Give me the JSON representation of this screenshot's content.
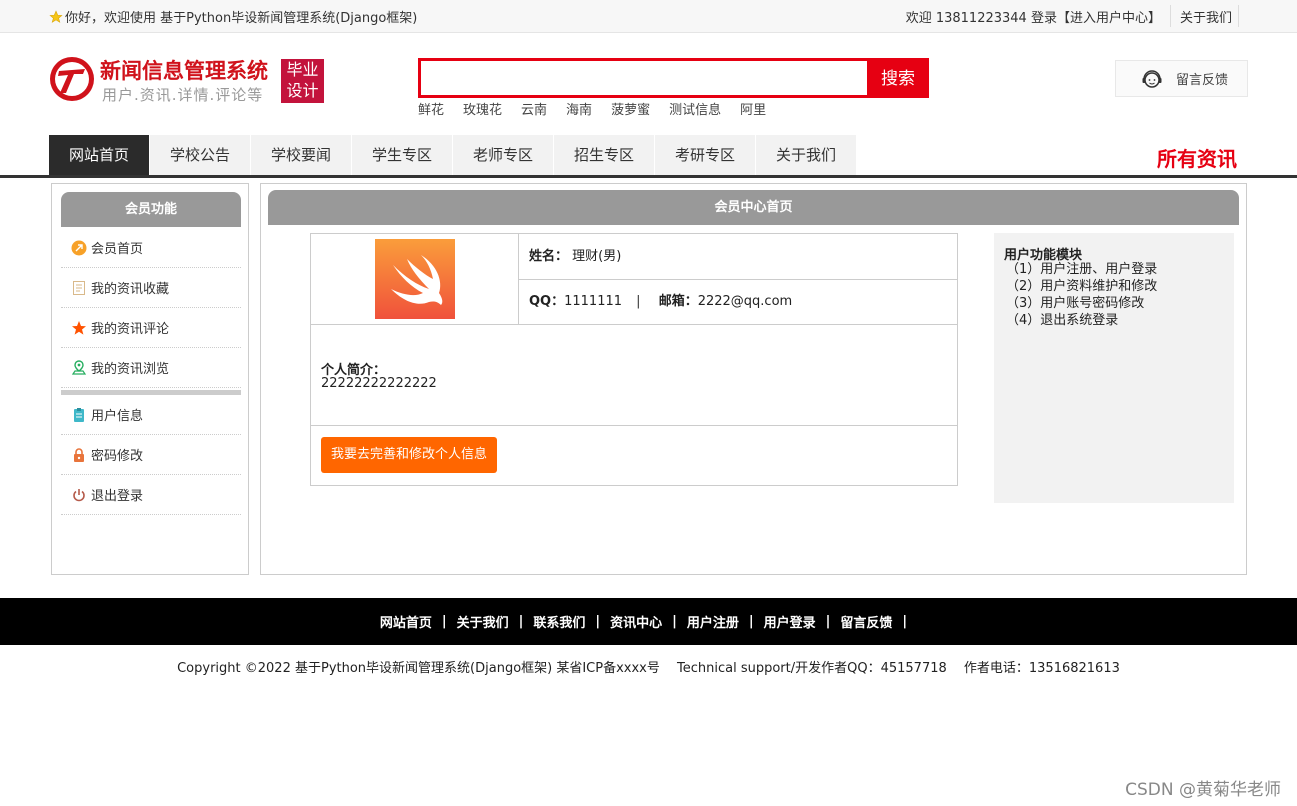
{
  "topbar": {
    "greeting": "你好，欢迎使用 基于Python毕设新闻管理系统(Django框架)",
    "welcome": "欢迎 13811223344 登录",
    "user_center": "【进入用户中心】",
    "about": "关于我们"
  },
  "logo": {
    "title": "新闻信息管理系统",
    "subtitle": "用户.资讯.详情.评论等",
    "badge_line1": "毕业",
    "badge_line2": "设计"
  },
  "search": {
    "value": "",
    "button": "搜索",
    "hotwords": [
      "鲜花",
      "玫瑰花",
      "云南",
      "海南",
      "菠萝蜜",
      "测试信息",
      "阿里"
    ]
  },
  "feedback": {
    "label": "留言反馈"
  },
  "nav": {
    "items": [
      "网站首页",
      "学校公告",
      "学校要闻",
      "学生专区",
      "老师专区",
      "招生专区",
      "考研专区",
      "关于我们"
    ],
    "right": "所有资讯"
  },
  "sidebar": {
    "title": "会员功能",
    "items": [
      "会员首页",
      "我的资讯收藏",
      "我的资讯评论",
      "我的资讯浏览"
    ],
    "items2": [
      "用户信息",
      "密码修改",
      "退出登录"
    ]
  },
  "main": {
    "title": "会员中心首页",
    "name_label": "姓名：",
    "name_value": "理财(男)",
    "qq_label": "QQ：",
    "qq_value": "1111111",
    "divider": "|",
    "email_label": "邮箱：",
    "email_value": "2222@qq.com",
    "intro_label": "个人简介：",
    "intro_value": "22222222222222",
    "edit_button": "我要去完善和修改个人信息"
  },
  "modules": {
    "title": "用户功能模块",
    "items": [
      "（1）用户注册、用户登录",
      "（2）用户资料维护和修改",
      "（3）用户账号密码修改",
      "（4）退出系统登录"
    ]
  },
  "footer": {
    "links": [
      "网站首页",
      "关于我们",
      "联系我们",
      "资讯中心",
      "用户注册",
      "用户登录",
      "留言反馈"
    ],
    "separator": "|",
    "copyright": "Copyright ©2022 基于Python毕设新闻管理系统(Django框架) 某省ICP备xxxx号　 Technical support/开发作者QQ：45157718　 作者电话：13516821613"
  },
  "watermark": "CSDN @黄菊华老师",
  "colors": {
    "brand_red": "#e60012",
    "accent_orange": "#ff6600",
    "header_gray": "#999999"
  }
}
